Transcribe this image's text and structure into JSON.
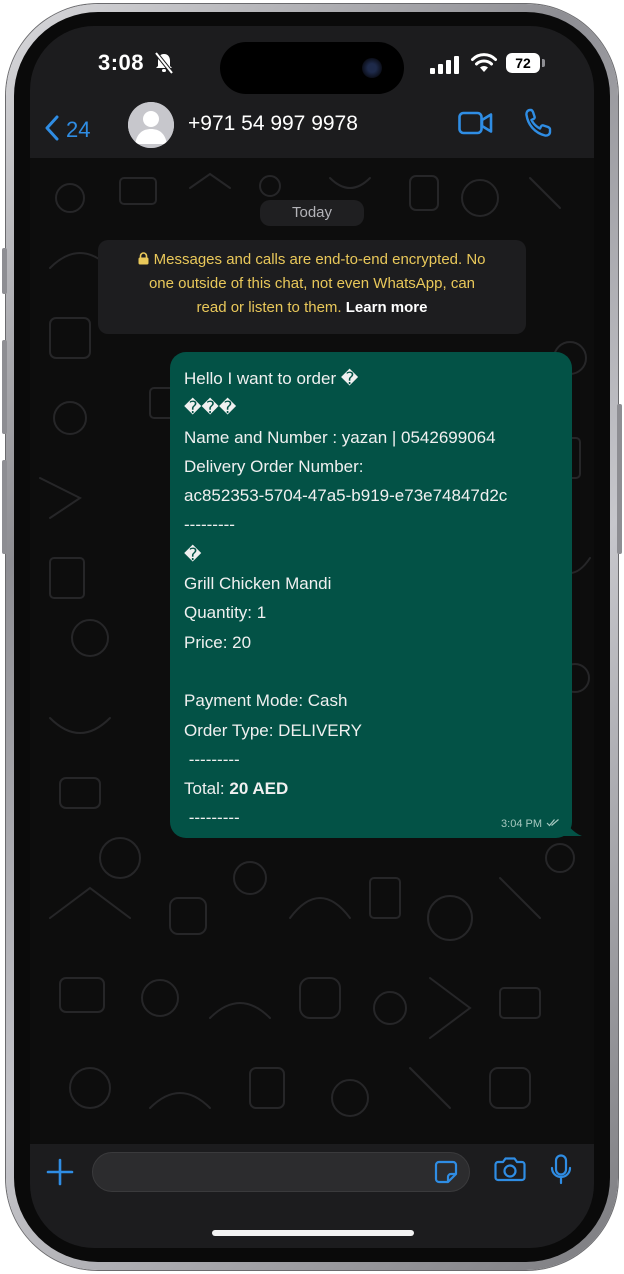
{
  "status_bar": {
    "time": "3:08",
    "battery": "72",
    "icons": [
      "mute-bell-icon",
      "signal-bars-icon",
      "wifi-icon",
      "battery-icon"
    ]
  },
  "header": {
    "back_count": "24",
    "contact_name": "+971 54 997 9978",
    "icons": [
      "chevron-left-icon",
      "avatar-placeholder-icon",
      "video-camera-icon",
      "phone-icon"
    ]
  },
  "chat": {
    "date_label": "Today",
    "encryption_notice": {
      "text": "Messages and calls are end-to-end encrypted. No one outside of this chat, not even WhatsApp, can read or listen to them.",
      "line1": "Messages and calls are end-to-end encrypted. No",
      "line2": "one outside of this chat, not even WhatsApp, can",
      "line3": "read or listen to them.",
      "link": "Learn more",
      "icon": "lock-icon"
    },
    "message": {
      "lines": [
        "Hello I want to order �",
        "���",
        "Name and Number : yazan | 0542699064",
        "Delivery Order Number:",
        "ac852353-5704-47a5-b919-e73e74847d2c",
        "---------",
        "�",
        "Grill Chicken Mandi",
        "Quantity: 1",
        "Price: 20",
        "",
        "Payment Mode: Cash",
        "Order Type: DELIVERY",
        " ---------",
        "",
        " ---------"
      ],
      "total_label": "Total: ",
      "total_value": "20 AED",
      "time": "3:04 PM",
      "status_icon": "double-check-icon",
      "bubble_color": "#035246"
    }
  },
  "input_bar": {
    "placeholder": "",
    "icons": [
      "plus-icon",
      "sticker-icon",
      "camera-icon",
      "microphone-icon"
    ]
  },
  "colors": {
    "accent": "#2f8de4",
    "notice_text": "#e9c85a",
    "bar_background": "#1c1c1e"
  }
}
